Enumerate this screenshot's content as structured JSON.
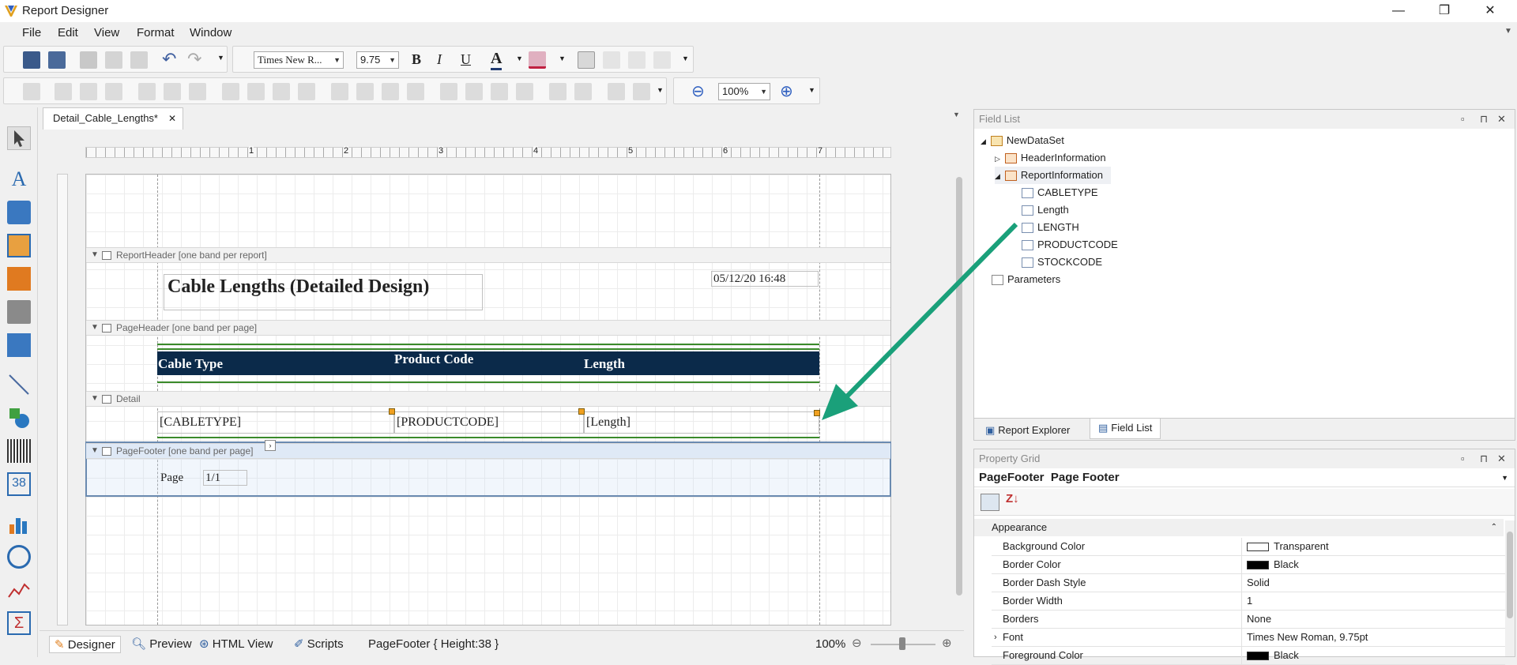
{
  "window": {
    "title": "Report Designer",
    "min": "—",
    "max": "❐",
    "close": "✕"
  },
  "menu": [
    "File",
    "Edit",
    "View",
    "Format",
    "Window"
  ],
  "toolbar": {
    "font_name": "Times New R...",
    "font_size": "9.75",
    "bold": "B",
    "italic": "I",
    "underline": "U",
    "zoom": "100%"
  },
  "document": {
    "tab_label": "Detail_Cable_Lengths*",
    "tab_close": "✕"
  },
  "ruler": [
    "1",
    "2",
    "3",
    "4",
    "5",
    "6",
    "7"
  ],
  "report": {
    "bands": {
      "report_header": "ReportHeader [one band per report]",
      "page_header": "PageHeader [one band per page]",
      "detail": "Detail",
      "page_footer": "PageFooter [one band per page]"
    },
    "title": "Cable Lengths (Detailed Design)",
    "date": "05/12/20 16:48",
    "columns": [
      "Cable Type",
      "Product Code",
      "Length"
    ],
    "detail_fields": [
      "[CABLETYPE]",
      "[PRODUCTCODE]",
      "[Length]"
    ],
    "footer_page_label": "Page",
    "footer_page_value": "1/1"
  },
  "field_list": {
    "title": "Field List",
    "root": "NewDataSet",
    "nodes": [
      "HeaderInformation",
      "ReportInformation"
    ],
    "fields": [
      "CABLETYPE",
      "Length",
      "LENGTH",
      "PRODUCTCODE",
      "STOCKCODE"
    ],
    "parameters": "Parameters",
    "tabs": [
      "Report Explorer",
      "Field List"
    ]
  },
  "property_grid": {
    "title": "Property Grid",
    "object_name": "PageFooter",
    "object_type": "Page Footer",
    "category": "Appearance",
    "rows": [
      {
        "k": "Background Color",
        "v": "Transparent",
        "swatch": "#ffffff"
      },
      {
        "k": "Border Color",
        "v": "Black",
        "swatch": "#000000"
      },
      {
        "k": "Border Dash Style",
        "v": "Solid"
      },
      {
        "k": "Border Width",
        "v": "1"
      },
      {
        "k": "Borders",
        "v": "None"
      },
      {
        "k": "Font",
        "v": "Times New Roman, 9.75pt"
      },
      {
        "k": "Foreground Color",
        "v": "Black",
        "swatch": "#000000"
      }
    ]
  },
  "status": {
    "designer": "Designer",
    "preview": "Preview",
    "html_view": "HTML View",
    "scripts": "Scripts",
    "info": "PageFooter { Height:38 }",
    "zoom": "100%"
  },
  "colors": {
    "header_band": "#0b2a4a",
    "accent_arrow": "#1aa07a",
    "green_line": "#3a8a2a"
  }
}
